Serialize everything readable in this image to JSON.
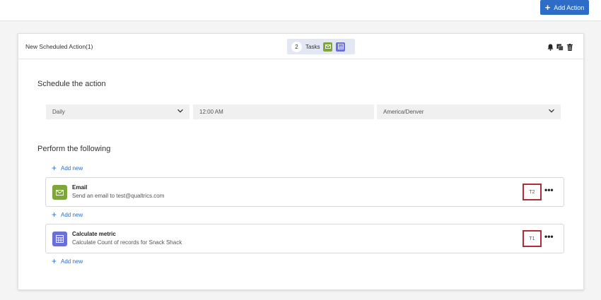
{
  "topbar": {
    "add_action_label": "Add Action"
  },
  "action": {
    "name": "New Scheduled Action(1)",
    "tasks_count": "2",
    "tasks_label": "Tasks"
  },
  "schedule": {
    "title": "Schedule the action",
    "frequency": "Daily",
    "time": "12:00 AM",
    "timezone": "America/Denver"
  },
  "perform": {
    "title": "Perform the following",
    "add_new_label": "Add new",
    "tasks": [
      {
        "title": "Email",
        "description": "Send an email to test@qualtrics.com",
        "badge": "T2",
        "icon": "envelope-icon",
        "color": "#7ea63b"
      },
      {
        "title": "Calculate metric",
        "description": "Calculate Count of records for Snack Shack",
        "badge": "T1",
        "icon": "calculator-icon",
        "color": "#6b6fd8"
      }
    ]
  },
  "colors": {
    "primary": "#2d6cc7",
    "highlight_border": "#b42a35"
  }
}
